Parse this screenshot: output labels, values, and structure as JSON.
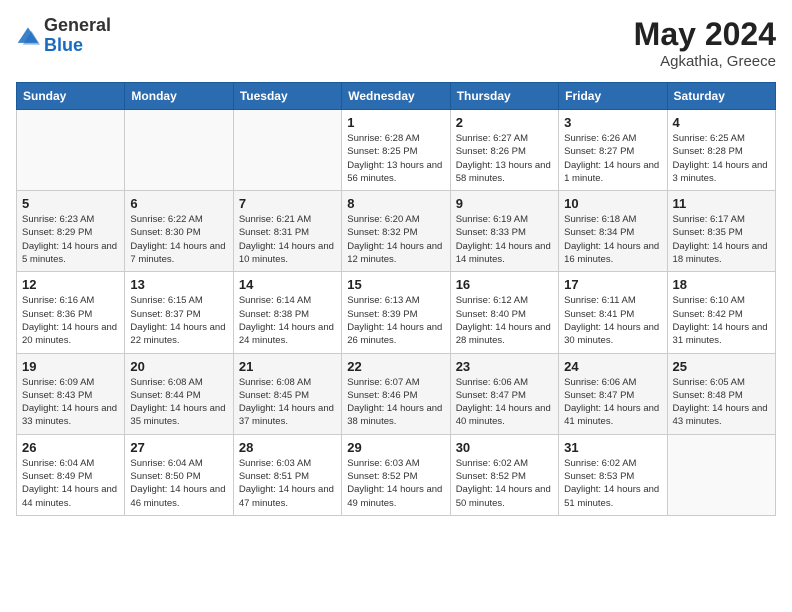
{
  "header": {
    "logo_general": "General",
    "logo_blue": "Blue",
    "month_title": "May 2024",
    "location": "Agkathia, Greece"
  },
  "weekdays": [
    "Sunday",
    "Monday",
    "Tuesday",
    "Wednesday",
    "Thursday",
    "Friday",
    "Saturday"
  ],
  "weeks": [
    [
      {
        "day": "",
        "sunrise": "",
        "sunset": "",
        "daylight": ""
      },
      {
        "day": "",
        "sunrise": "",
        "sunset": "",
        "daylight": ""
      },
      {
        "day": "",
        "sunrise": "",
        "sunset": "",
        "daylight": ""
      },
      {
        "day": "1",
        "sunrise": "Sunrise: 6:28 AM",
        "sunset": "Sunset: 8:25 PM",
        "daylight": "Daylight: 13 hours and 56 minutes."
      },
      {
        "day": "2",
        "sunrise": "Sunrise: 6:27 AM",
        "sunset": "Sunset: 8:26 PM",
        "daylight": "Daylight: 13 hours and 58 minutes."
      },
      {
        "day": "3",
        "sunrise": "Sunrise: 6:26 AM",
        "sunset": "Sunset: 8:27 PM",
        "daylight": "Daylight: 14 hours and 1 minute."
      },
      {
        "day": "4",
        "sunrise": "Sunrise: 6:25 AM",
        "sunset": "Sunset: 8:28 PM",
        "daylight": "Daylight: 14 hours and 3 minutes."
      }
    ],
    [
      {
        "day": "5",
        "sunrise": "Sunrise: 6:23 AM",
        "sunset": "Sunset: 8:29 PM",
        "daylight": "Daylight: 14 hours and 5 minutes."
      },
      {
        "day": "6",
        "sunrise": "Sunrise: 6:22 AM",
        "sunset": "Sunset: 8:30 PM",
        "daylight": "Daylight: 14 hours and 7 minutes."
      },
      {
        "day": "7",
        "sunrise": "Sunrise: 6:21 AM",
        "sunset": "Sunset: 8:31 PM",
        "daylight": "Daylight: 14 hours and 10 minutes."
      },
      {
        "day": "8",
        "sunrise": "Sunrise: 6:20 AM",
        "sunset": "Sunset: 8:32 PM",
        "daylight": "Daylight: 14 hours and 12 minutes."
      },
      {
        "day": "9",
        "sunrise": "Sunrise: 6:19 AM",
        "sunset": "Sunset: 8:33 PM",
        "daylight": "Daylight: 14 hours and 14 minutes."
      },
      {
        "day": "10",
        "sunrise": "Sunrise: 6:18 AM",
        "sunset": "Sunset: 8:34 PM",
        "daylight": "Daylight: 14 hours and 16 minutes."
      },
      {
        "day": "11",
        "sunrise": "Sunrise: 6:17 AM",
        "sunset": "Sunset: 8:35 PM",
        "daylight": "Daylight: 14 hours and 18 minutes."
      }
    ],
    [
      {
        "day": "12",
        "sunrise": "Sunrise: 6:16 AM",
        "sunset": "Sunset: 8:36 PM",
        "daylight": "Daylight: 14 hours and 20 minutes."
      },
      {
        "day": "13",
        "sunrise": "Sunrise: 6:15 AM",
        "sunset": "Sunset: 8:37 PM",
        "daylight": "Daylight: 14 hours and 22 minutes."
      },
      {
        "day": "14",
        "sunrise": "Sunrise: 6:14 AM",
        "sunset": "Sunset: 8:38 PM",
        "daylight": "Daylight: 14 hours and 24 minutes."
      },
      {
        "day": "15",
        "sunrise": "Sunrise: 6:13 AM",
        "sunset": "Sunset: 8:39 PM",
        "daylight": "Daylight: 14 hours and 26 minutes."
      },
      {
        "day": "16",
        "sunrise": "Sunrise: 6:12 AM",
        "sunset": "Sunset: 8:40 PM",
        "daylight": "Daylight: 14 hours and 28 minutes."
      },
      {
        "day": "17",
        "sunrise": "Sunrise: 6:11 AM",
        "sunset": "Sunset: 8:41 PM",
        "daylight": "Daylight: 14 hours and 30 minutes."
      },
      {
        "day": "18",
        "sunrise": "Sunrise: 6:10 AM",
        "sunset": "Sunset: 8:42 PM",
        "daylight": "Daylight: 14 hours and 31 minutes."
      }
    ],
    [
      {
        "day": "19",
        "sunrise": "Sunrise: 6:09 AM",
        "sunset": "Sunset: 8:43 PM",
        "daylight": "Daylight: 14 hours and 33 minutes."
      },
      {
        "day": "20",
        "sunrise": "Sunrise: 6:08 AM",
        "sunset": "Sunset: 8:44 PM",
        "daylight": "Daylight: 14 hours and 35 minutes."
      },
      {
        "day": "21",
        "sunrise": "Sunrise: 6:08 AM",
        "sunset": "Sunset: 8:45 PM",
        "daylight": "Daylight: 14 hours and 37 minutes."
      },
      {
        "day": "22",
        "sunrise": "Sunrise: 6:07 AM",
        "sunset": "Sunset: 8:46 PM",
        "daylight": "Daylight: 14 hours and 38 minutes."
      },
      {
        "day": "23",
        "sunrise": "Sunrise: 6:06 AM",
        "sunset": "Sunset: 8:47 PM",
        "daylight": "Daylight: 14 hours and 40 minutes."
      },
      {
        "day": "24",
        "sunrise": "Sunrise: 6:06 AM",
        "sunset": "Sunset: 8:47 PM",
        "daylight": "Daylight: 14 hours and 41 minutes."
      },
      {
        "day": "25",
        "sunrise": "Sunrise: 6:05 AM",
        "sunset": "Sunset: 8:48 PM",
        "daylight": "Daylight: 14 hours and 43 minutes."
      }
    ],
    [
      {
        "day": "26",
        "sunrise": "Sunrise: 6:04 AM",
        "sunset": "Sunset: 8:49 PM",
        "daylight": "Daylight: 14 hours and 44 minutes."
      },
      {
        "day": "27",
        "sunrise": "Sunrise: 6:04 AM",
        "sunset": "Sunset: 8:50 PM",
        "daylight": "Daylight: 14 hours and 46 minutes."
      },
      {
        "day": "28",
        "sunrise": "Sunrise: 6:03 AM",
        "sunset": "Sunset: 8:51 PM",
        "daylight": "Daylight: 14 hours and 47 minutes."
      },
      {
        "day": "29",
        "sunrise": "Sunrise: 6:03 AM",
        "sunset": "Sunset: 8:52 PM",
        "daylight": "Daylight: 14 hours and 49 minutes."
      },
      {
        "day": "30",
        "sunrise": "Sunrise: 6:02 AM",
        "sunset": "Sunset: 8:52 PM",
        "daylight": "Daylight: 14 hours and 50 minutes."
      },
      {
        "day": "31",
        "sunrise": "Sunrise: 6:02 AM",
        "sunset": "Sunset: 8:53 PM",
        "daylight": "Daylight: 14 hours and 51 minutes."
      },
      {
        "day": "",
        "sunrise": "",
        "sunset": "",
        "daylight": ""
      }
    ]
  ]
}
